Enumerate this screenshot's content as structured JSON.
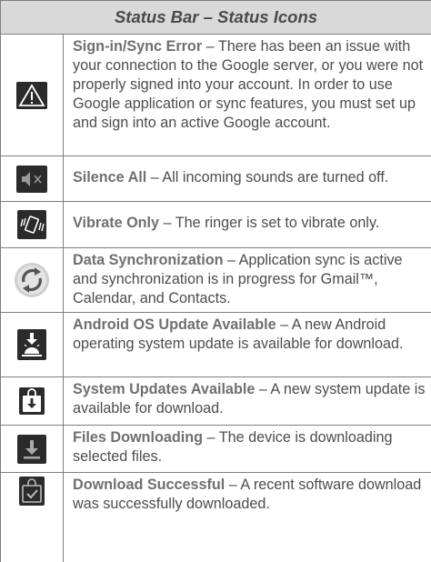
{
  "header": {
    "title": "Status Bar – Status Icons"
  },
  "rows": [
    {
      "icon": "warning-triangle-icon",
      "title": "Sign-in/Sync Error",
      "desc": " – There has been an issue with your connection to the Google server, or you were not properly signed into your account. In order to use Google application or sync features, you must set up and sign into an active Google account."
    },
    {
      "icon": "speaker-mute-icon",
      "title": "Silence All",
      "desc": " – All incoming sounds are turned off."
    },
    {
      "icon": "vibrate-phone-icon",
      "title": "Vibrate Only",
      "desc": " – The ringer is set to vibrate only."
    },
    {
      "icon": "sync-arrows-icon",
      "title": "Data Synchronization",
      "desc": " – Application sync is active and synchronization is in progress for Gmail™, Calendar, and Contacts."
    },
    {
      "icon": "android-update-icon",
      "title": "Android OS Update Available",
      "desc": " – A new Android operating system update is available for download."
    },
    {
      "icon": "system-update-bag-icon",
      "title": "System Updates Available",
      "desc": " – A new system update is available for download."
    },
    {
      "icon": "download-arrow-icon",
      "title": "Files Downloading",
      "desc": " – The device is downloading selected files."
    },
    {
      "icon": "download-success-bag-icon",
      "title": "Download Successful",
      "desc": " – A recent software download was successfully downloaded."
    }
  ]
}
